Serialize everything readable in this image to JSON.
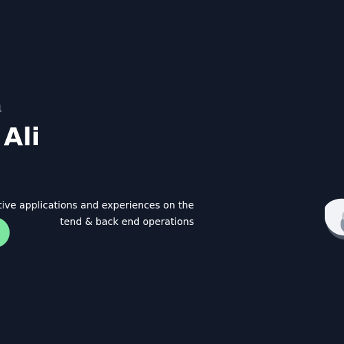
{
  "hero": {
    "greeting": "1",
    "name": "Ali",
    "description_line1": "ractive applications and experiences on the",
    "description_line2": "tend & back end operations",
    "cta_label": ""
  },
  "colors": {
    "background": "#121a2a",
    "text": "#ffffff",
    "accent": "#7ce6a0",
    "avatar_blob": "#f1f3f6",
    "avatar_shadow": "#4b5563"
  },
  "icons": {
    "avatar": "profile-avatar-icon"
  }
}
